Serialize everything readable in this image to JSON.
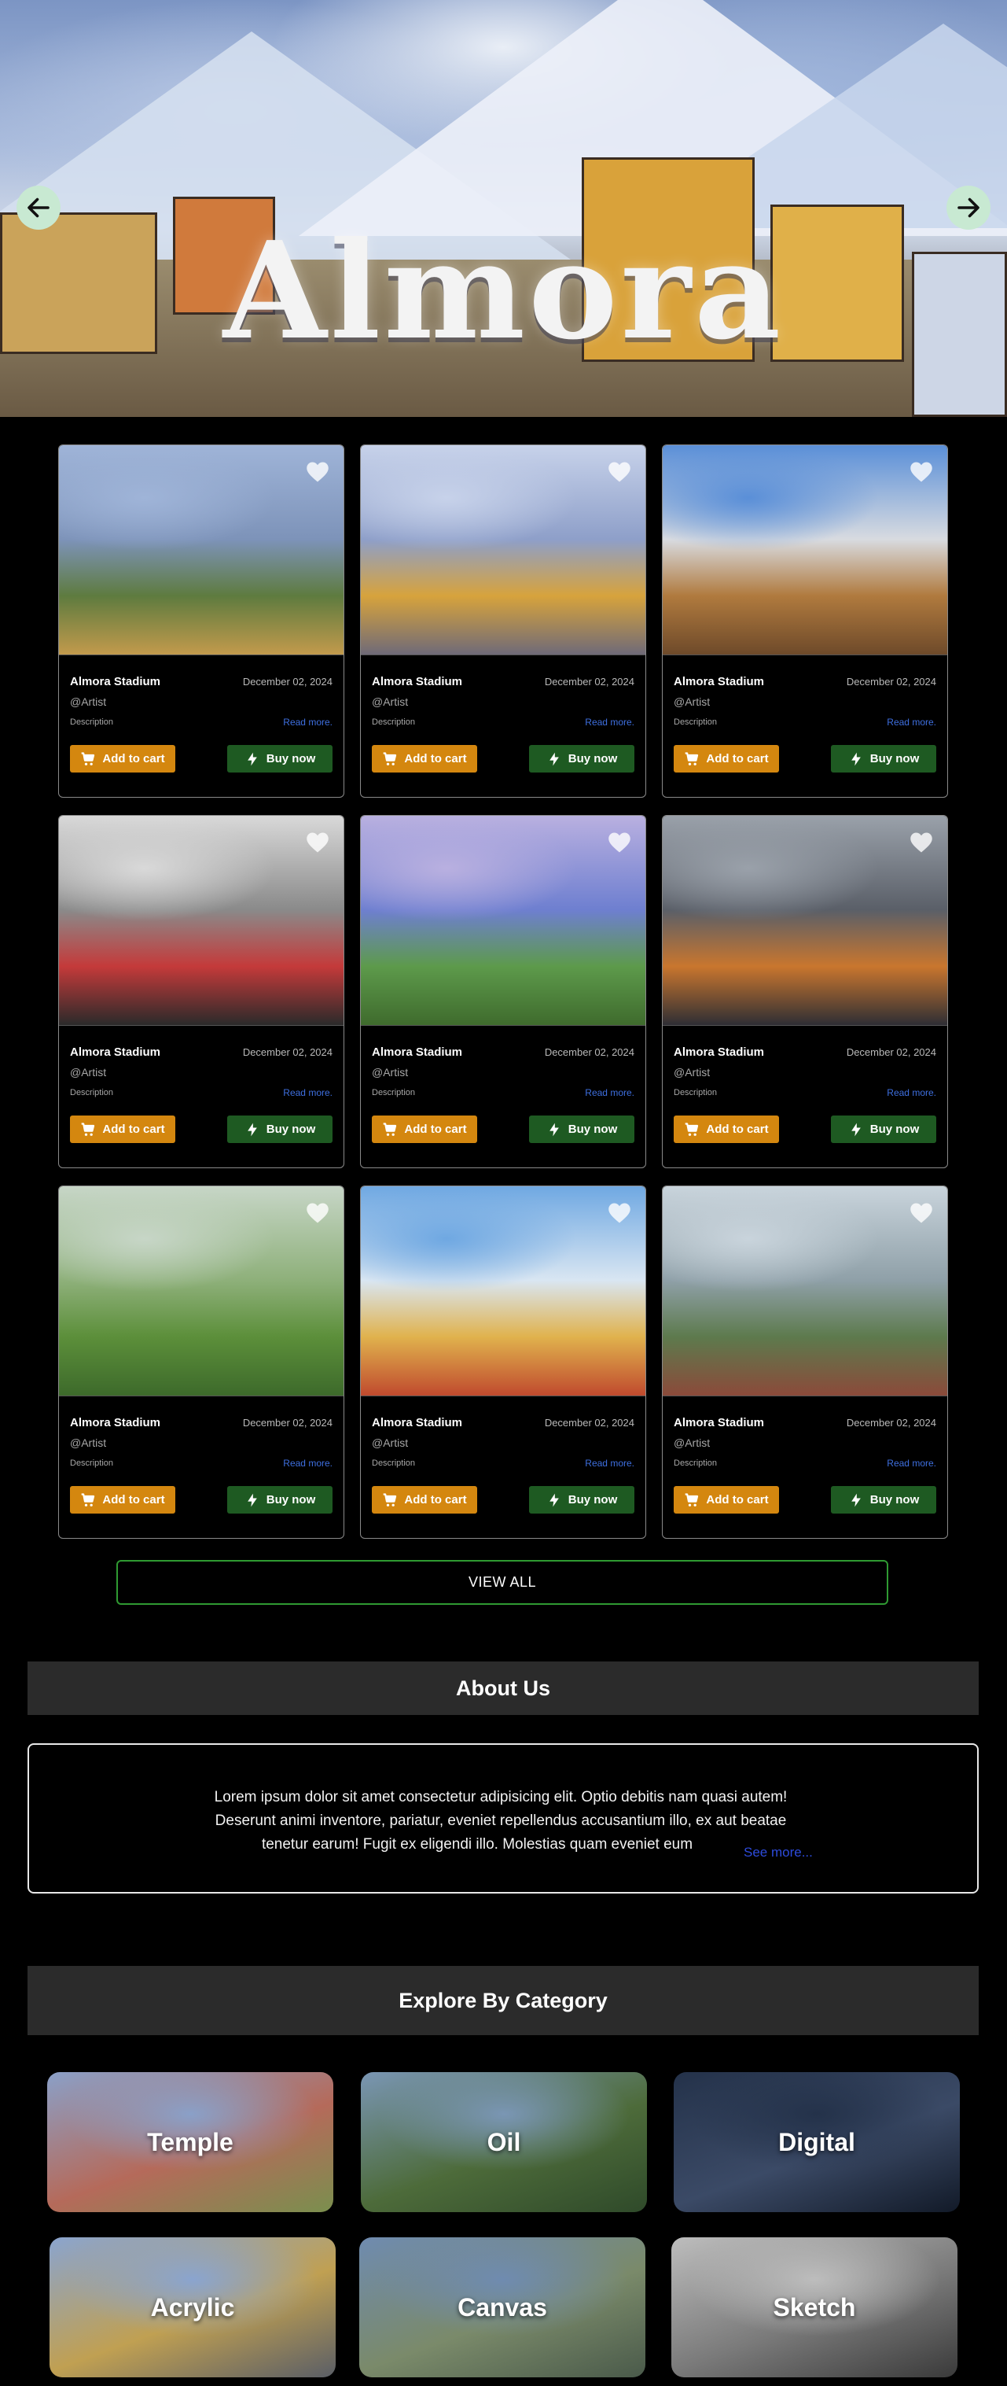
{
  "hero": {
    "title": "Almora",
    "prev_icon": "arrow-left-icon",
    "next_icon": "arrow-right-icon"
  },
  "products": [
    {
      "title": "Almora Stadium",
      "date": "December 02, 2024",
      "artist": "@Artist",
      "description": "Description",
      "read_more": "Read more.",
      "add_to_cart": "Add to cart",
      "buy_now": "Buy now",
      "palette": [
        "#9fb4d8",
        "#7d93b9",
        "#5e7b3f",
        "#c29a4c"
      ]
    },
    {
      "title": "Almora Stadium",
      "date": "December 02, 2024",
      "artist": "@Artist",
      "description": "Description",
      "read_more": "Read more.",
      "add_to_cart": "Add to cart",
      "buy_now": "Buy now",
      "palette": [
        "#c7d2ea",
        "#8e9fc9",
        "#d7a33c",
        "#6f6a78"
      ]
    },
    {
      "title": "Almora Stadium",
      "date": "December 02, 2024",
      "artist": "@Artist",
      "description": "Description",
      "read_more": "Read more.",
      "add_to_cart": "Add to cart",
      "buy_now": "Buy now",
      "palette": [
        "#5a8fd8",
        "#d8dbe0",
        "#b07a3e",
        "#6e4a2a"
      ]
    },
    {
      "title": "Almora Stadium",
      "date": "December 02, 2024",
      "artist": "@Artist",
      "description": "Description",
      "read_more": "Read more.",
      "add_to_cart": "Add to cart",
      "buy_now": "Buy now",
      "palette": [
        "#d9d9d9",
        "#8a8a8a",
        "#c43a3a",
        "#2a2a2a"
      ]
    },
    {
      "title": "Almora Stadium",
      "date": "December 02, 2024",
      "artist": "@Artist",
      "description": "Description",
      "read_more": "Read more.",
      "add_to_cart": "Add to cart",
      "buy_now": "Buy now",
      "palette": [
        "#b9b0e0",
        "#6e7fd0",
        "#5d9a4b",
        "#3f6b2d"
      ]
    },
    {
      "title": "Almora Stadium",
      "date": "December 02, 2024",
      "artist": "@Artist",
      "description": "Description",
      "read_more": "Read more.",
      "add_to_cart": "Add to cart",
      "buy_now": "Buy now",
      "palette": [
        "#9aa1aa",
        "#5a5f68",
        "#c9762e",
        "#2e2e34"
      ]
    },
    {
      "title": "Almora Stadium",
      "date": "December 02, 2024",
      "artist": "@Artist",
      "description": "Description",
      "read_more": "Read more.",
      "add_to_cart": "Add to cart",
      "buy_now": "Buy now",
      "palette": [
        "#c7d6c7",
        "#8eb07a",
        "#5c8f3a",
        "#3d6a2b"
      ]
    },
    {
      "title": "Almora Stadium",
      "date": "December 02, 2024",
      "artist": "@Artist",
      "description": "Description",
      "read_more": "Read more.",
      "add_to_cart": "Add to cart",
      "buy_now": "Buy now",
      "palette": [
        "#6fa8e2",
        "#d9e6f2",
        "#e0b24d",
        "#c04a2e"
      ]
    },
    {
      "title": "Almora Stadium",
      "date": "December 02, 2024",
      "artist": "@Artist",
      "description": "Description",
      "read_more": "Read more.",
      "add_to_cart": "Add to cart",
      "buy_now": "Buy now",
      "palette": [
        "#c9d4dc",
        "#8fa0a8",
        "#5d7a4d",
        "#8b4a3a"
      ]
    }
  ],
  "view_all": "VIEW ALL",
  "about": {
    "heading": "About Us",
    "line1": "Lorem ipsum dolor sit amet consectetur adipisicing elit. Optio debitis nam quasi autem!",
    "line2": "Deserunt animi inventore, pariatur, eveniet repellendus accusantium illo, ex aut beatae",
    "line3": "tenetur earum! Fugit ex eligendi illo. Molestias quam eveniet eum",
    "see_more": "See more..."
  },
  "categories": {
    "heading": "Explore By Category",
    "items": [
      {
        "label": "Temple",
        "palette": [
          "#8aa0c8",
          "#b56a5a",
          "#7a8f4e"
        ]
      },
      {
        "label": "Oil",
        "palette": [
          "#7a96b4",
          "#4d6b3a",
          "#2f4a2a"
        ]
      },
      {
        "label": "Digital",
        "palette": [
          "#24324a",
          "#3b4a66",
          "#121a28"
        ]
      },
      {
        "label": "Acrylic",
        "palette": [
          "#8aa4cf",
          "#c0a052",
          "#5a5e66"
        ]
      },
      {
        "label": "Canvas",
        "palette": [
          "#6f8bb0",
          "#7a8a6a",
          "#4a5a4a"
        ]
      },
      {
        "label": "Sketch",
        "palette": [
          "#bdbdbd",
          "#7a7a7a",
          "#3a3a3a"
        ]
      }
    ]
  }
}
